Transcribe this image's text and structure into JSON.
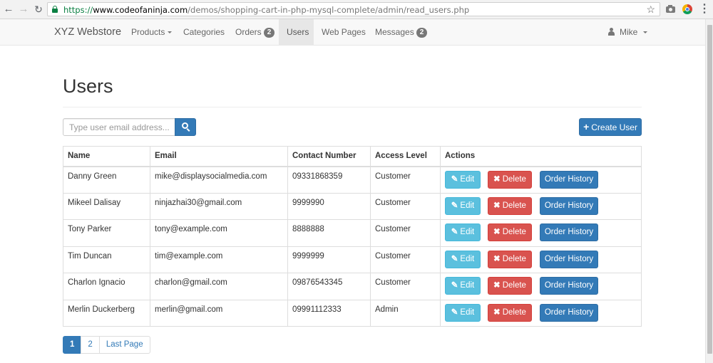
{
  "browser": {
    "url_scheme": "https://",
    "url_host": "www.codeofaninja.com",
    "url_path": "/demos/shopping-cart-in-php-mysql-complete/admin/read_users.php"
  },
  "navbar": {
    "brand": "XYZ Webstore",
    "items": [
      {
        "label": "Products",
        "dropdown": true
      },
      {
        "label": "Categories"
      },
      {
        "label": "Orders",
        "badge": "2"
      },
      {
        "label": "Users",
        "active": true
      },
      {
        "label": "Web Pages"
      },
      {
        "label": "Messages",
        "badge": "2"
      }
    ],
    "user": "Mike"
  },
  "page": {
    "title": "Users",
    "search_placeholder": "Type user email address...",
    "create_label": "Create User"
  },
  "table": {
    "headers": [
      "Name",
      "Email",
      "Contact Number",
      "Access Level",
      "Actions"
    ],
    "rows": [
      {
        "name": "Danny Green",
        "email": "mike@displaysocialmedia.com",
        "contact": "09331868359",
        "level": "Customer"
      },
      {
        "name": "Mikeel Dalisay",
        "email": "ninjazhai30@gmail.com",
        "contact": "9999990",
        "level": "Customer"
      },
      {
        "name": "Tony Parker",
        "email": "tony@example.com",
        "contact": "8888888",
        "level": "Customer"
      },
      {
        "name": "Tim Duncan",
        "email": "tim@example.com",
        "contact": "9999999",
        "level": "Customer"
      },
      {
        "name": "Charlon Ignacio",
        "email": "charlon@gmail.com",
        "contact": "09876543345",
        "level": "Customer"
      },
      {
        "name": "Merlin Duckerberg",
        "email": "merlin@gmail.com",
        "contact": "09991112333",
        "level": "Admin"
      }
    ],
    "actions": {
      "edit": "Edit",
      "delete": "Delete",
      "orders": "Order History"
    }
  },
  "pagination": [
    "1",
    "2",
    "Last Page"
  ],
  "colors": {
    "primary": "#337ab7",
    "info": "#5bc0de",
    "danger": "#d9534f"
  }
}
